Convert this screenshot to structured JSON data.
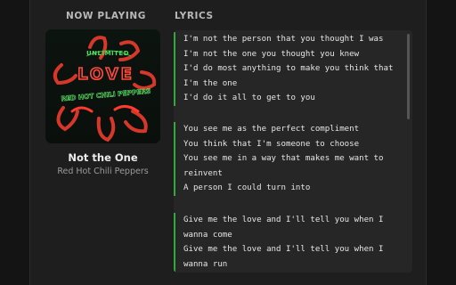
{
  "headers": {
    "now_playing": "NOW PLAYING",
    "lyrics": "LYRICS"
  },
  "track": {
    "title": "Not the One",
    "artist": "Red Hot Chili Peppers"
  },
  "album_art": {
    "neon_text_top": "UNLIMITED",
    "neon_text_main": "LOVE",
    "neon_text_band": "RED HOT CHILI PEPPERS"
  },
  "lyrics": {
    "stanzas": [
      {
        "lines": [
          "I'm not the person that you thought I was",
          "I'm not the one you thought you knew",
          "I'd do most anything to make you think that",
          "I'm the one",
          "I'd do it all to get to you"
        ]
      },
      {
        "lines": [
          "You see me as the perfect compliment",
          "You think that I'm someone to choose",
          "You see me in a way that makes me want to",
          "reinvent",
          "A person I could turn into"
        ]
      },
      {
        "lines": [
          "Give me the love and I'll tell you when I",
          "wanna come",
          "Give me the love and I'll tell you when I",
          "wanna run"
        ]
      }
    ]
  },
  "colors": {
    "accent": "#2faa3c",
    "background": "#1e1e1e",
    "panel": "#262626"
  }
}
